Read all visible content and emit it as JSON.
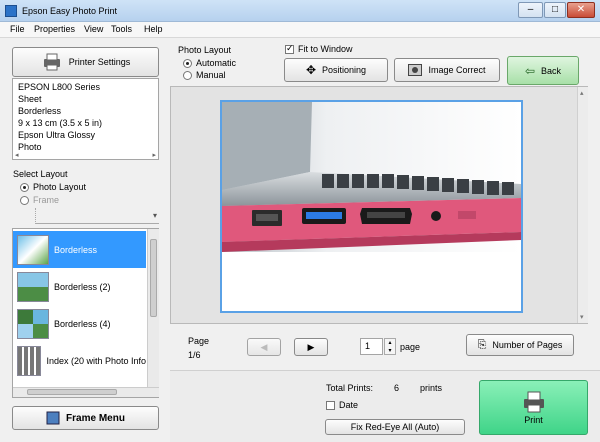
{
  "window": {
    "title": "Epson Easy Photo Print"
  },
  "menu": [
    "File",
    "Properties",
    "View",
    "Tools",
    "Help"
  ],
  "left": {
    "printer_settings_label": "Printer Settings",
    "printer_info": [
      "EPSON L800 Series",
      "Sheet",
      "Borderless",
      "9 x 13 cm (3.5 x 5 in)",
      "Epson Ultra Glossy",
      "Photo"
    ],
    "select_layout_label": "Select Layout",
    "layout_modes": [
      {
        "label": "Photo Layout",
        "selected": true,
        "enabled": true
      },
      {
        "label": "Frame",
        "selected": false,
        "enabled": false
      }
    ],
    "layouts": [
      {
        "label": "Borderless",
        "selected": true
      },
      {
        "label": "Borderless (2)",
        "selected": false
      },
      {
        "label": "Borderless (4)",
        "selected": false
      },
      {
        "label": "Index (20 with Photo Info",
        "selected": false
      }
    ],
    "frame_menu_label": "Frame Menu"
  },
  "toolbar": {
    "photo_layout_label": "Photo Layout",
    "photo_layout_options": [
      {
        "label": "Automatic",
        "selected": true
      },
      {
        "label": "Manual",
        "selected": false
      }
    ],
    "fit_to_window": {
      "label": "Fit to Window",
      "checked": true
    },
    "positioning_label": "Positioning",
    "image_correct_label": "Image Correct",
    "back_label": "Back"
  },
  "pager": {
    "page_label": "Page",
    "page_position": "1/6",
    "copies_value": "1",
    "copies_unit": "page",
    "number_of_pages_label": "Number of Pages"
  },
  "footer": {
    "total_prints_label": "Total Prints:",
    "total_prints_value": "6",
    "total_prints_unit": "prints",
    "date": {
      "label": "Date",
      "checked": false
    },
    "fix_redeye_label": "Fix Red-Eye All (Auto)",
    "print_label": "Print"
  },
  "colors": {
    "accent": "#3399ff",
    "back_button": "#a8e0a8",
    "print_button": "#3fd488",
    "laptop_body": "#e0587c"
  }
}
